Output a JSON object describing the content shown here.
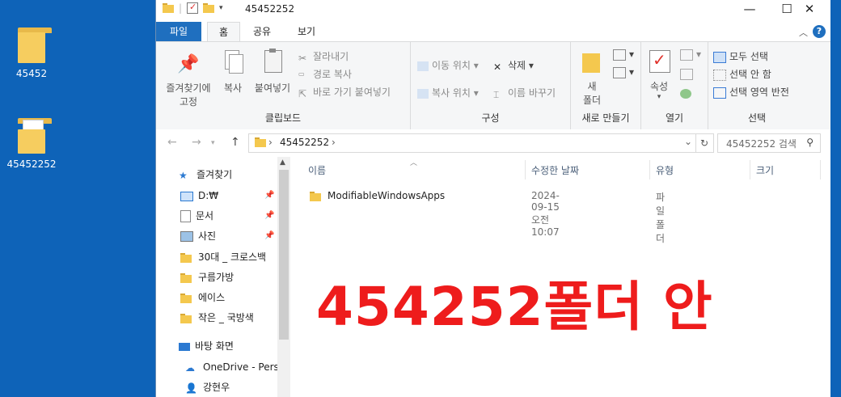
{
  "desktop": {
    "icons": [
      {
        "label": "45452"
      },
      {
        "label": "45452252"
      }
    ]
  },
  "window": {
    "title": "45452252",
    "controls": {
      "minimize": "—",
      "maximize": "☐",
      "close": "✕"
    }
  },
  "ribbon_tabs": {
    "file": "파일",
    "home": "홈",
    "share": "공유",
    "view": "보기"
  },
  "ribbon": {
    "clipboard": {
      "pin_label_1": "즐겨찾기에",
      "pin_label_2": "고정",
      "copy": "복사",
      "paste": "붙여넣기",
      "cut": "잘라내기",
      "copy_path": "경로 복사",
      "paste_shortcut": "바로 가기 붙여넣기",
      "group": "클립보드"
    },
    "organize": {
      "move_to": "이동 위치",
      "copy_to": "복사 위치",
      "delete": "삭제",
      "rename": "이름 바꾸기",
      "group": "구성"
    },
    "new": {
      "new_folder_1": "새",
      "new_folder_2": "폴더",
      "group": "새로 만들기"
    },
    "open": {
      "properties": "속성",
      "group": "열기"
    },
    "select": {
      "select_all": "모두 선택",
      "select_none": "선택 안 함",
      "invert": "선택 영역 반전",
      "group": "선택"
    }
  },
  "address": {
    "path": "45452252",
    "search_placeholder": "45452252 검색"
  },
  "nav": {
    "quick_access": "즐겨찾기",
    "items": [
      {
        "label": "D:₩",
        "pinned": true
      },
      {
        "label": "문서",
        "pinned": true
      },
      {
        "label": "사진",
        "pinned": true
      },
      {
        "label": "30대 _ 크로스백",
        "pinned": false
      },
      {
        "label": "구름가방",
        "pinned": false
      },
      {
        "label": "에이스",
        "pinned": false
      },
      {
        "label": "작은 _ 국방색",
        "pinned": false
      }
    ],
    "desktop": "바탕 화면",
    "onedrive": "OneDrive - Pers",
    "user": "강현우"
  },
  "columns": {
    "name": "이름",
    "modified": "수정한 날짜",
    "type": "유형",
    "size": "크기"
  },
  "files": [
    {
      "name": "ModifiableWindowsApps",
      "modified": "2024-09-15 오전 10:07",
      "type": "파일 폴더"
    }
  ],
  "overlay_text": "454252폴더 안",
  "colors": {
    "desktop": "#0e63b8",
    "accent": "#1f6fbf",
    "overlay": "#ee1c1c",
    "folder": "#f7cf62"
  }
}
